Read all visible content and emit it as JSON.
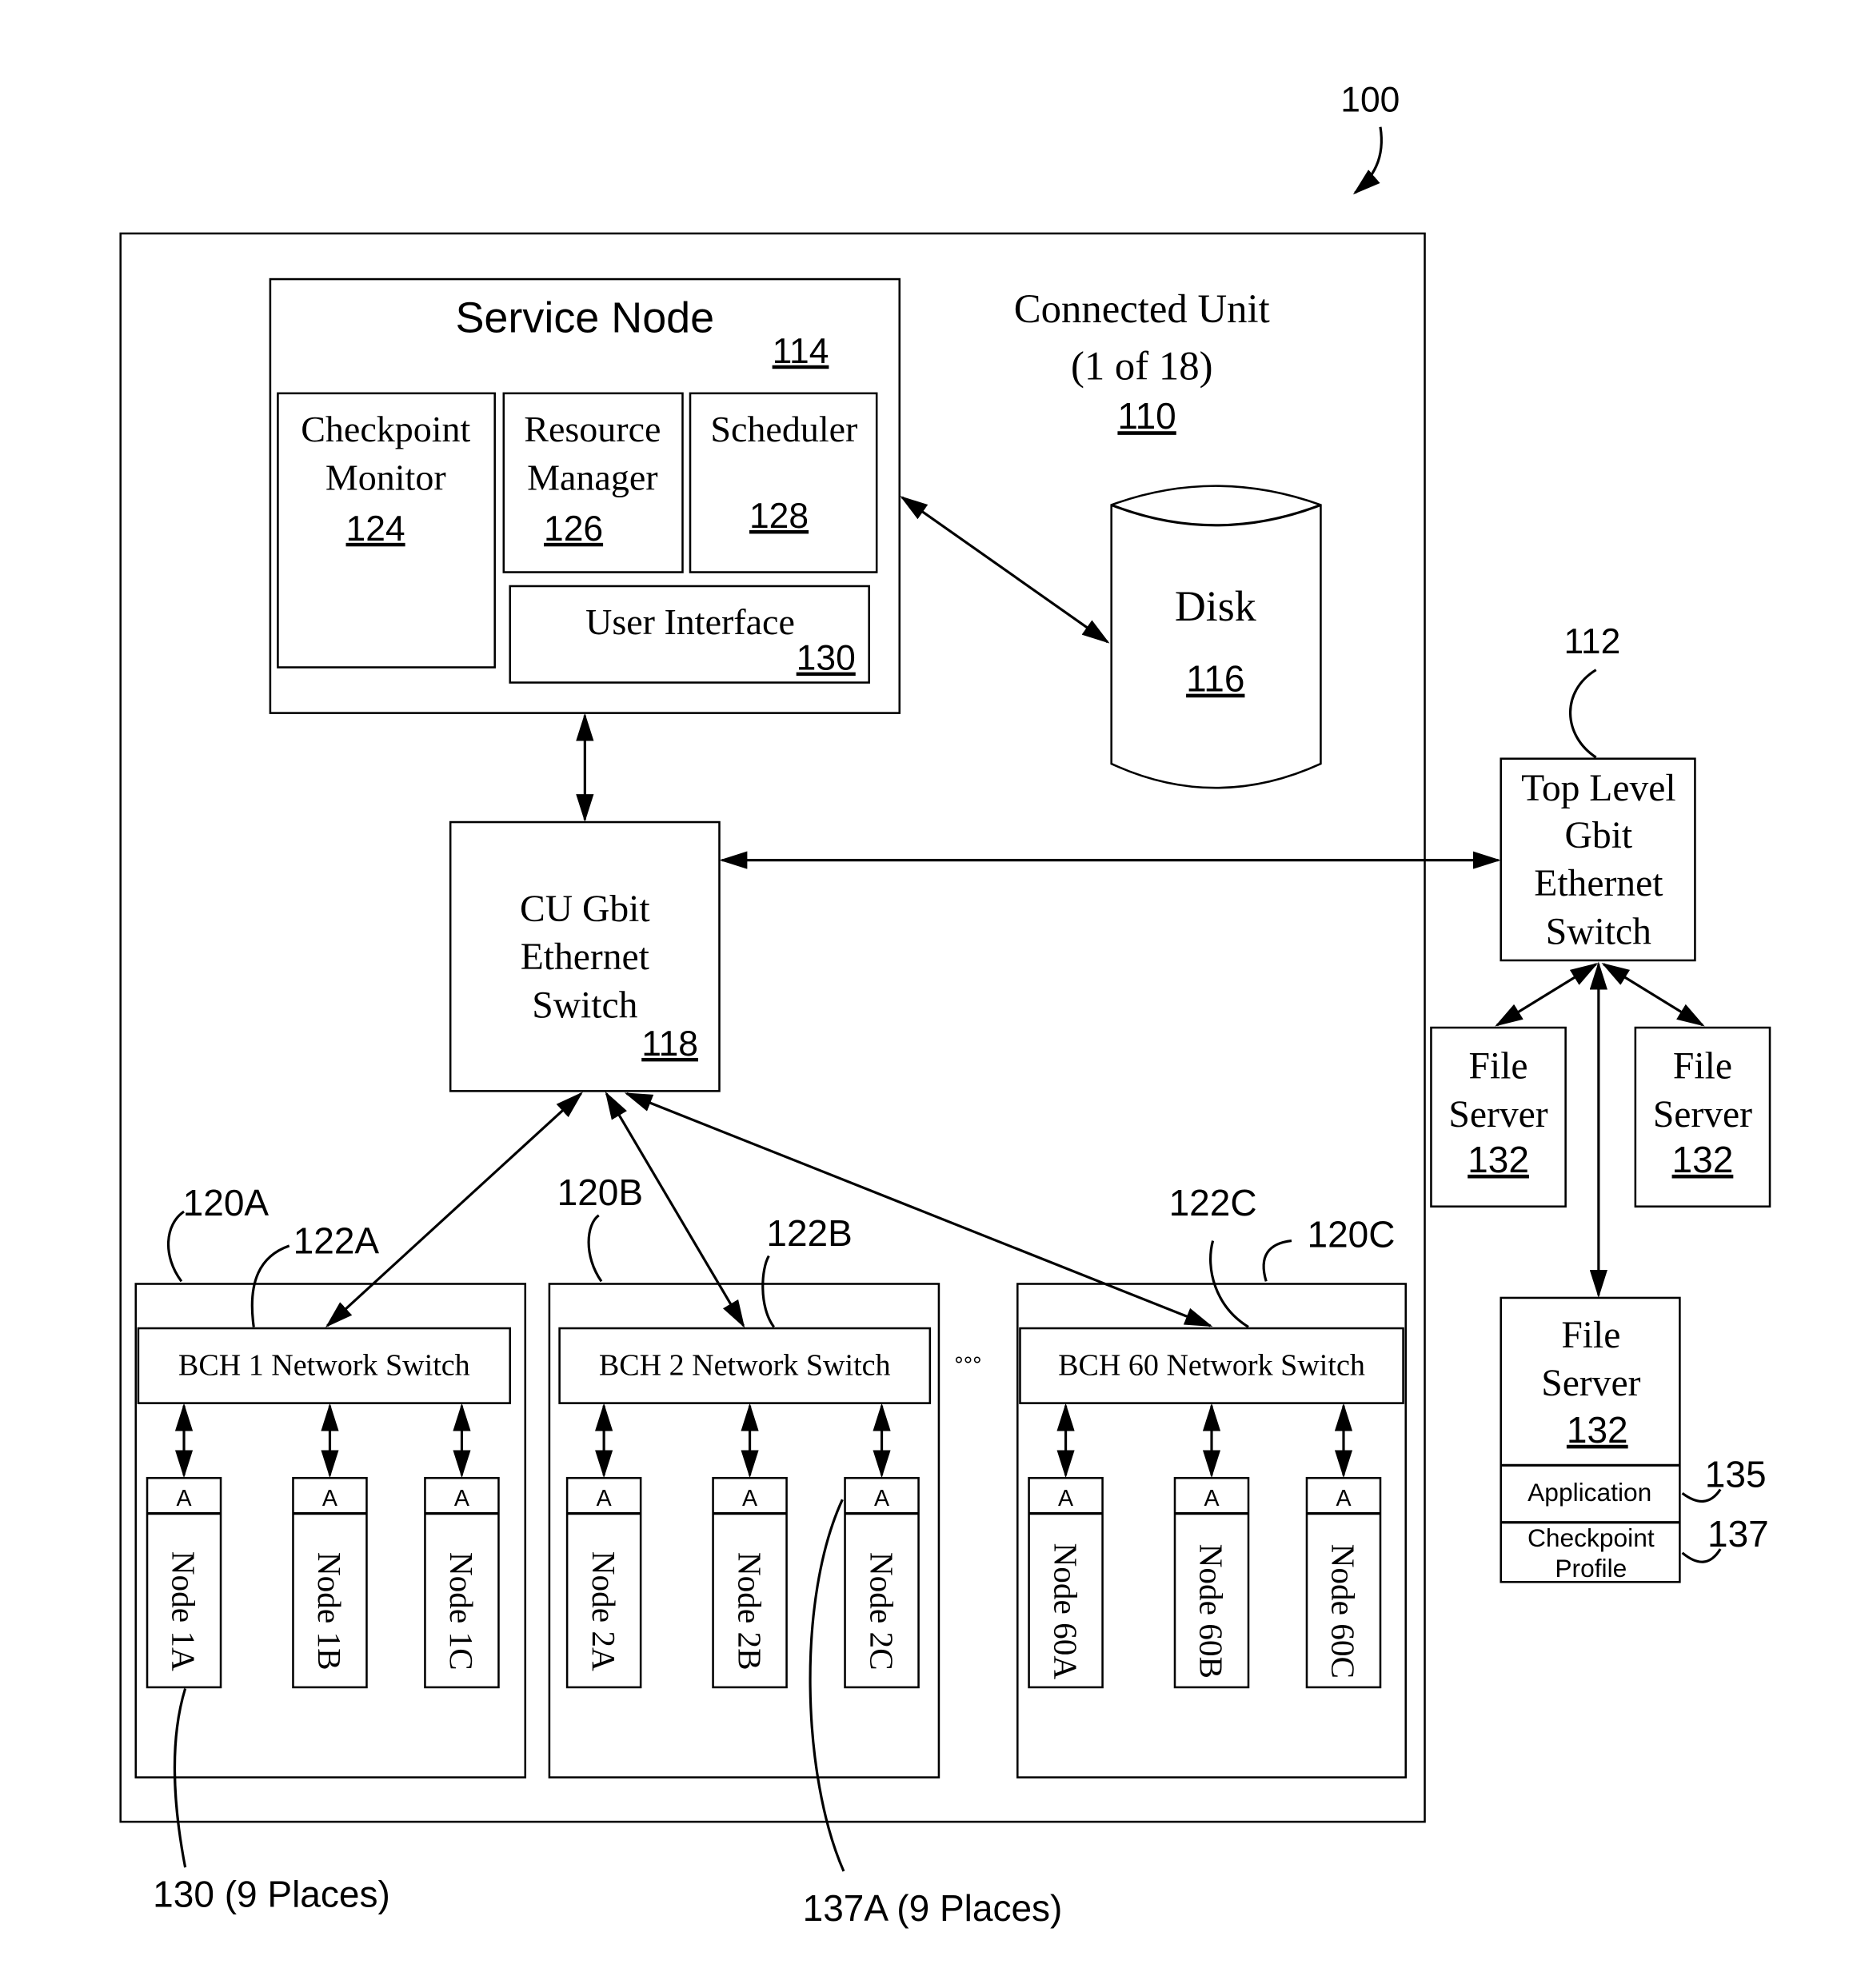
{
  "figure_ref": "100",
  "connected_unit": {
    "title_line1": "Connected Unit",
    "title_line2": "(1 of 18)",
    "ref": "110"
  },
  "service_node": {
    "title": "Service Node",
    "ref": "114",
    "checkpoint_monitor": {
      "line1": "Checkpoint",
      "line2": "Monitor",
      "ref": "124"
    },
    "resource_manager": {
      "line1": "Resource",
      "line2": "Manager",
      "ref": "126"
    },
    "scheduler": {
      "line1": "Scheduler",
      "ref": "128"
    },
    "user_interface": {
      "label": "User Interface",
      "ref": "130"
    }
  },
  "disk": {
    "label": "Disk",
    "ref": "116"
  },
  "cu_switch": {
    "line1": "CU Gbit",
    "line2": "Ethernet",
    "line3": "Switch",
    "ref": "118"
  },
  "top_switch": {
    "ref": "112",
    "line1": "Top Level",
    "line2": "Gbit",
    "line3": "Ethernet",
    "line4": "Switch"
  },
  "file_servers": [
    {
      "line1": "File",
      "line2": "Server",
      "ref": "132"
    },
    {
      "line1": "File",
      "line2": "Server",
      "ref": "132"
    },
    {
      "line1": "File",
      "line2": "Server",
      "ref": "132",
      "application": "Application",
      "app_ref": "135",
      "profile_line1": "Checkpoint",
      "profile_line2": "Profile",
      "profile_ref": "137"
    }
  ],
  "bch_groups": [
    {
      "group_ref": "120A",
      "switch_ref": "122A",
      "switch_label": "BCH 1 Network Switch",
      "nodes": [
        "Node 1A",
        "Node 1B",
        "Node 1C"
      ]
    },
    {
      "group_ref": "120B",
      "switch_ref": "122B",
      "switch_label": "BCH 2 Network Switch",
      "nodes": [
        "Node 2A",
        "Node 2B",
        "Node 2C"
      ]
    },
    {
      "group_ref": "120C",
      "switch_ref": "122C",
      "switch_label": "BCH 60 Network Switch",
      "nodes": [
        "Node 60A",
        "Node 60B",
        "Node 60C"
      ]
    }
  ],
  "node_agent_label": "A",
  "ellipsis": "°°°",
  "callouts": {
    "nodes": "130 (9 Places)",
    "agents": "137A (9 Places)"
  }
}
